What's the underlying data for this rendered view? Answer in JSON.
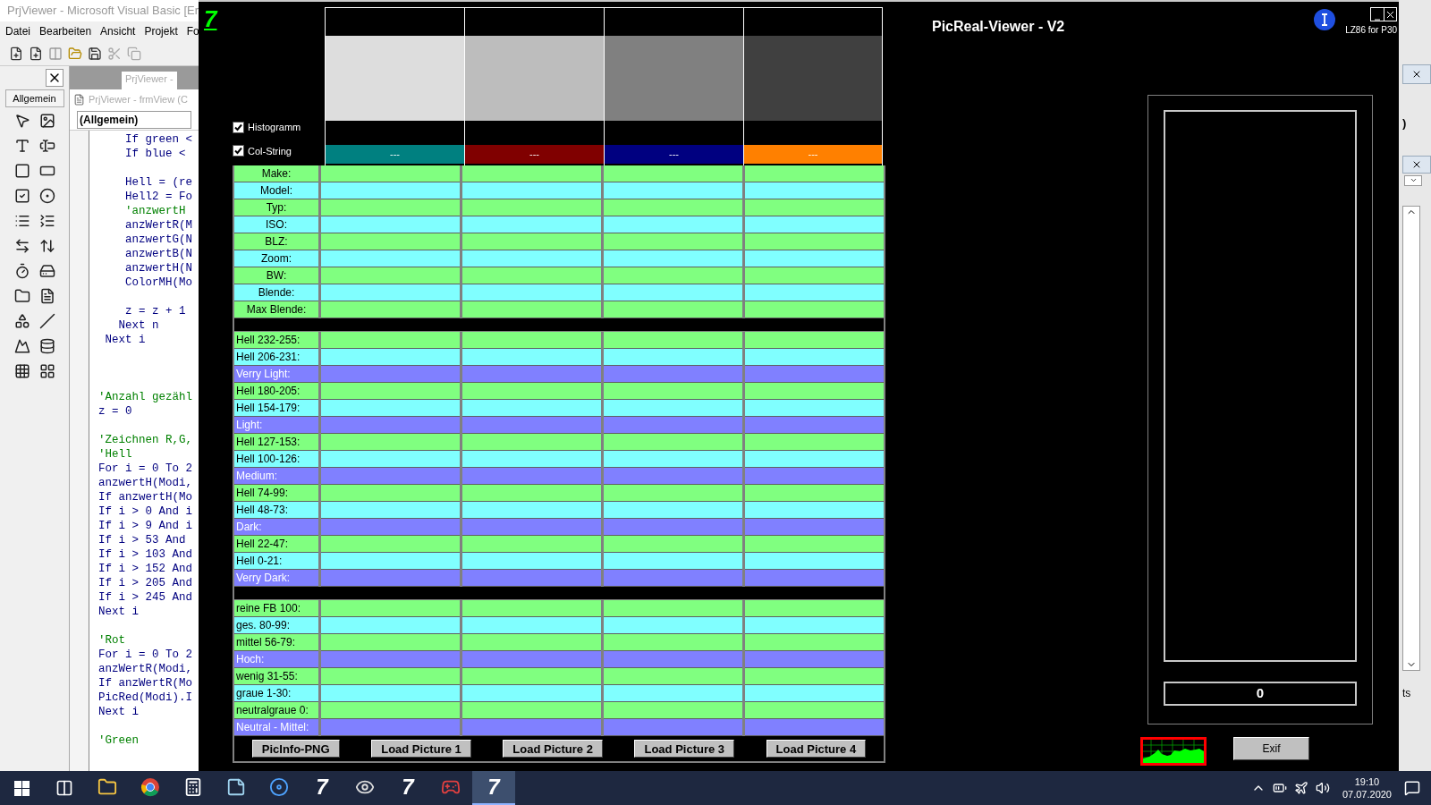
{
  "ide": {
    "title": "PrjViewer - Microsoft Visual Basic [Er",
    "menu": [
      "Datei",
      "Bearbeiten",
      "Ansicht",
      "Projekt",
      "Fo"
    ],
    "toolbox_tab": "Allgemein",
    "mdi_tab": "PrjViewer -",
    "code_window": {
      "title": "PrjViewer - frmView (C",
      "object_combo": "(Allgemein)",
      "lines": [
        {
          "kind": "code",
          "text": "    If green <"
        },
        {
          "kind": "code",
          "text": "    If blue <"
        },
        {
          "kind": "blank"
        },
        {
          "kind": "code",
          "text": "    Hell = (re"
        },
        {
          "kind": "code",
          "text": "    Hell2 = Fo"
        },
        {
          "kind": "comment",
          "text": "    'anzwertH"
        },
        {
          "kind": "code",
          "text": "    anzWertR(M"
        },
        {
          "kind": "code",
          "text": "    anzwertG(N"
        },
        {
          "kind": "code",
          "text": "    anzwertB(N"
        },
        {
          "kind": "code",
          "text": "    anzwertH(N"
        },
        {
          "kind": "code",
          "text": "    ColorMH(Mo"
        },
        {
          "kind": "blank"
        },
        {
          "kind": "code",
          "text": "    z = z + 1"
        },
        {
          "kind": "code",
          "text": "   Next n"
        },
        {
          "kind": "code",
          "text": " Next i"
        },
        {
          "kind": "blank"
        },
        {
          "kind": "blank"
        },
        {
          "kind": "blank"
        },
        {
          "kind": "comment",
          "text": "'Anzahl gezähl"
        },
        {
          "kind": "code",
          "text": "z = 0"
        },
        {
          "kind": "blank"
        },
        {
          "kind": "comment",
          "text": "'Zeichnen R,G,"
        },
        {
          "kind": "comment",
          "text": "'Hell"
        },
        {
          "kind": "code",
          "text": "For i = 0 To 2"
        },
        {
          "kind": "code",
          "text": "anzwertH(Modi,"
        },
        {
          "kind": "code",
          "text": "If anzwertH(Mo"
        },
        {
          "kind": "code",
          "text": "If i > 0 And i"
        },
        {
          "kind": "code",
          "text": "If i > 9 And i"
        },
        {
          "kind": "code",
          "text": "If i > 53 And"
        },
        {
          "kind": "code",
          "text": "If i > 103 And"
        },
        {
          "kind": "code",
          "text": "If i > 152 And"
        },
        {
          "kind": "code",
          "text": "If i > 205 And"
        },
        {
          "kind": "code",
          "text": "If i > 245 And"
        },
        {
          "kind": "code",
          "text": "Next i"
        },
        {
          "kind": "blank"
        },
        {
          "kind": "comment",
          "text": "'Rot"
        },
        {
          "kind": "code",
          "text": "For i = 0 To 2"
        },
        {
          "kind": "code",
          "text": "anzWertR(Modi,"
        },
        {
          "kind": "code",
          "text": "If anzWertR(Mo"
        },
        {
          "kind": "code",
          "text": "PicRed(Modi).I"
        },
        {
          "kind": "code",
          "text": "Next i"
        },
        {
          "kind": "blank"
        },
        {
          "kind": "comment",
          "text": "'Green"
        }
      ]
    }
  },
  "app": {
    "logo": "7",
    "title": "PicReal-Viewer - V2",
    "credit": "LZ86 for P30",
    "options": [
      {
        "label": "Histogramm",
        "checked": true
      },
      {
        "label": "Col-String",
        "checked": true
      }
    ],
    "pictures": [
      {
        "preview": {
          "color": "#dddddd"
        },
        "strip": {
          "color": "#008080",
          "label": "---"
        }
      },
      {
        "preview": {
          "color": "#bdbdbd"
        },
        "strip": {
          "color": "#800000",
          "label": "---"
        }
      },
      {
        "preview": {
          "color": "#808080"
        },
        "strip": {
          "color": "#000080",
          "label": "---"
        }
      },
      {
        "preview": {
          "color": "#404040"
        },
        "strip": {
          "color": "#ff8000",
          "label": "---"
        }
      }
    ],
    "rows": [
      {
        "kind": "field",
        "label": "Make:",
        "color": "#80ff80"
      },
      {
        "kind": "field",
        "label": "Model:",
        "color": "#80ffff"
      },
      {
        "kind": "field",
        "label": "Typ:",
        "color": "#80ff80"
      },
      {
        "kind": "field",
        "label": "ISO:",
        "color": "#80ffff"
      },
      {
        "kind": "field",
        "label": "BLZ:",
        "color": "#80ff80"
      },
      {
        "kind": "field",
        "label": "Zoom:",
        "color": "#80ffff"
      },
      {
        "kind": "field",
        "label": "BW:",
        "color": "#80ff80"
      },
      {
        "kind": "field",
        "label": "Blende:",
        "color": "#80ffff"
      },
      {
        "kind": "field",
        "label": "Max Blende:",
        "color": "#80ff80"
      },
      {
        "kind": "separator"
      },
      {
        "kind": "range",
        "label": "Hell 232-255:",
        "color": "#80ff80"
      },
      {
        "kind": "range",
        "label": "Hell 206-231:",
        "color": "#80ffff"
      },
      {
        "kind": "group",
        "label": "Verry Light:",
        "color": "#8080ff"
      },
      {
        "kind": "range",
        "label": "Hell 180-205:",
        "color": "#80ff80"
      },
      {
        "kind": "range",
        "label": "Hell 154-179:",
        "color": "#80ffff"
      },
      {
        "kind": "group",
        "label": "Light:",
        "color": "#8080ff"
      },
      {
        "kind": "range",
        "label": "Hell 127-153:",
        "color": "#80ff80"
      },
      {
        "kind": "range",
        "label": "Hell 100-126:",
        "color": "#80ffff"
      },
      {
        "kind": "group",
        "label": "Medium:",
        "color": "#8080ff"
      },
      {
        "kind": "range",
        "label": "Hell 74-99:",
        "color": "#80ff80"
      },
      {
        "kind": "range",
        "label": "Hell 48-73:",
        "color": "#80ffff"
      },
      {
        "kind": "group",
        "label": "Dark:",
        "color": "#8080ff"
      },
      {
        "kind": "range",
        "label": "Hell 22-47:",
        "color": "#80ff80"
      },
      {
        "kind": "range",
        "label": "Hell 0-21:",
        "color": "#80ffff"
      },
      {
        "kind": "group",
        "label": "Verry Dark:",
        "color": "#8080ff"
      },
      {
        "kind": "separator"
      },
      {
        "kind": "range",
        "label": "reine FB 100:",
        "color": "#80ff80"
      },
      {
        "kind": "range",
        "label": "ges. 80-99:",
        "color": "#80ffff"
      },
      {
        "kind": "range",
        "label": "mittel 56-79:",
        "color": "#80ff80"
      },
      {
        "kind": "group",
        "label": "Hoch:",
        "color": "#8080ff"
      },
      {
        "kind": "range",
        "label": "wenig 31-55:",
        "color": "#80ff80"
      },
      {
        "kind": "range",
        "label": "graue  1-30:",
        "color": "#80ffff"
      },
      {
        "kind": "range",
        "label": "neutralgraue 0:",
        "color": "#80ff80"
      },
      {
        "kind": "group",
        "label": "Neutral - Mittel:",
        "color": "#8080ff"
      }
    ],
    "buttons": [
      "PicInfo-PNG",
      "Load Picture 1",
      "Load Picture 2",
      "Load Picture 3",
      "Load Picture 4"
    ],
    "readout": "0",
    "exif_button": "Exif"
  },
  "side_windows": {
    "texts": [
      ")",
      "ts"
    ]
  },
  "taskbar": {
    "time": "19:10",
    "date": "07.07.2020",
    "apps": [
      {
        "kind": "explorer",
        "selected": false
      },
      {
        "kind": "browser",
        "selected": false
      },
      {
        "kind": "calculator",
        "selected": false
      },
      {
        "kind": "notes",
        "selected": false
      },
      {
        "kind": "media",
        "selected": false
      },
      {
        "kind": "logo",
        "label": "7",
        "selected": false
      },
      {
        "kind": "eye",
        "selected": false
      },
      {
        "kind": "logo",
        "label": "7",
        "selected": false
      },
      {
        "kind": "game",
        "selected": false
      },
      {
        "kind": "logo",
        "label": "7",
        "selected": true
      }
    ]
  }
}
